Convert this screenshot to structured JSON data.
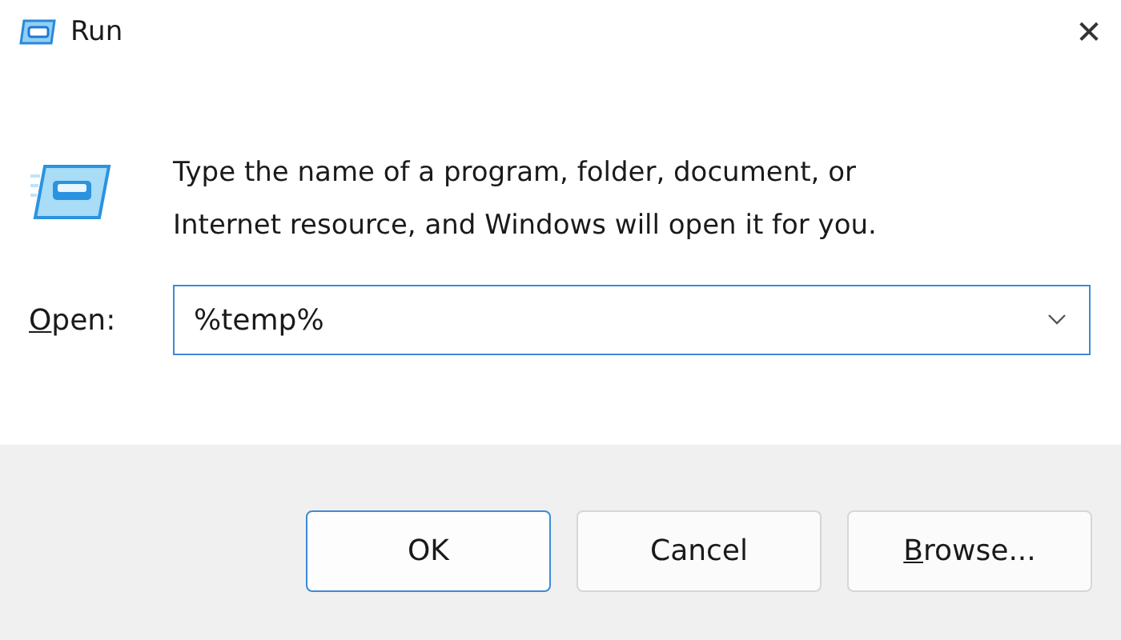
{
  "window": {
    "title": "Run",
    "close": "✕"
  },
  "message": "Type the name of a program, folder, document, or Internet resource, and Windows will open it for you.",
  "open_field": {
    "label_accel": "O",
    "label_rest": "pen:",
    "value": "%temp%"
  },
  "buttons": [
    {
      "rest": "OK",
      "default": true
    },
    {
      "rest": "Cancel",
      "default": false
    },
    {
      "accel": "B",
      "rest": "rowse...",
      "default": false
    }
  ]
}
